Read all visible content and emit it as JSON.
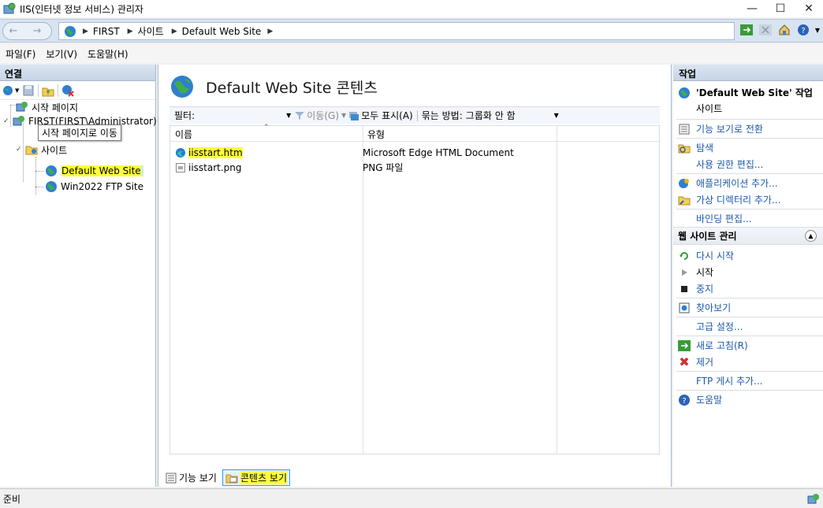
{
  "window": {
    "title": "IIS(인터넷 정보 서비스) 관리자"
  },
  "address": {
    "crumbs": [
      "FIRST",
      "사이트",
      "Default Web Site"
    ]
  },
  "menu": [
    "파일(F)",
    "보기(V)",
    "도움말(H)"
  ],
  "connections": {
    "header": "연결",
    "tree": {
      "start_page": "시작 페이지",
      "server": "FIRST(FIRST\\Administrator)",
      "tooltip": "시작 페이지로 이동",
      "sites": "사이트",
      "site1": "Default Web Site",
      "site2": "Win2022 FTP Site"
    }
  },
  "content": {
    "title": "Default Web Site 콘텐츠",
    "filter_label": "필터:",
    "go_label": "이동(G)",
    "show_all_label": "모두 표시(A)",
    "group_by_label": "묶는 방법:",
    "group_by_value": "그룹화 안 함",
    "columns": [
      "이름",
      "유형"
    ],
    "rows": [
      {
        "name": "iisstart.htm",
        "type": "Microsoft Edge HTML Document"
      },
      {
        "name": "iisstart.png",
        "type": "PNG 파일"
      }
    ],
    "tabs": {
      "features": "기능 보기",
      "content": "콘텐츠 보기"
    }
  },
  "actions": {
    "header": "작업",
    "site_title": "'Default Web Site' 작업",
    "site_sub": "사이트",
    "items_top": [
      {
        "label": "기능 보기로 전환",
        "icon": "features-view-icon"
      },
      {
        "label": "탐색",
        "icon": "explore-icon"
      },
      {
        "label": "사용 권한 편집...",
        "icon": ""
      },
      {
        "label": "애플리케이션 추가...",
        "icon": "add-application-icon"
      },
      {
        "label": "가상 디렉터리 추가...",
        "icon": "add-virtual-directory-icon"
      },
      {
        "label": "바인딩 편집...",
        "icon": ""
      }
    ],
    "manage_header": "웹 사이트 관리",
    "manage_items": {
      "restart": "다시 시작",
      "start": "시작",
      "stop": "중지",
      "browse": "찾아보기",
      "advanced": "고급 설정...",
      "refresh": "새로 고침(R)",
      "remove": "제거",
      "ftp": "FTP 게시 추가...",
      "help": "도움말"
    }
  },
  "status": {
    "text": "준비"
  },
  "colors": {
    "link": "#1e5aa8",
    "highlight": "#ffff3a",
    "selection": "#cde8ff",
    "header_gradient": "#c6d4e6"
  }
}
